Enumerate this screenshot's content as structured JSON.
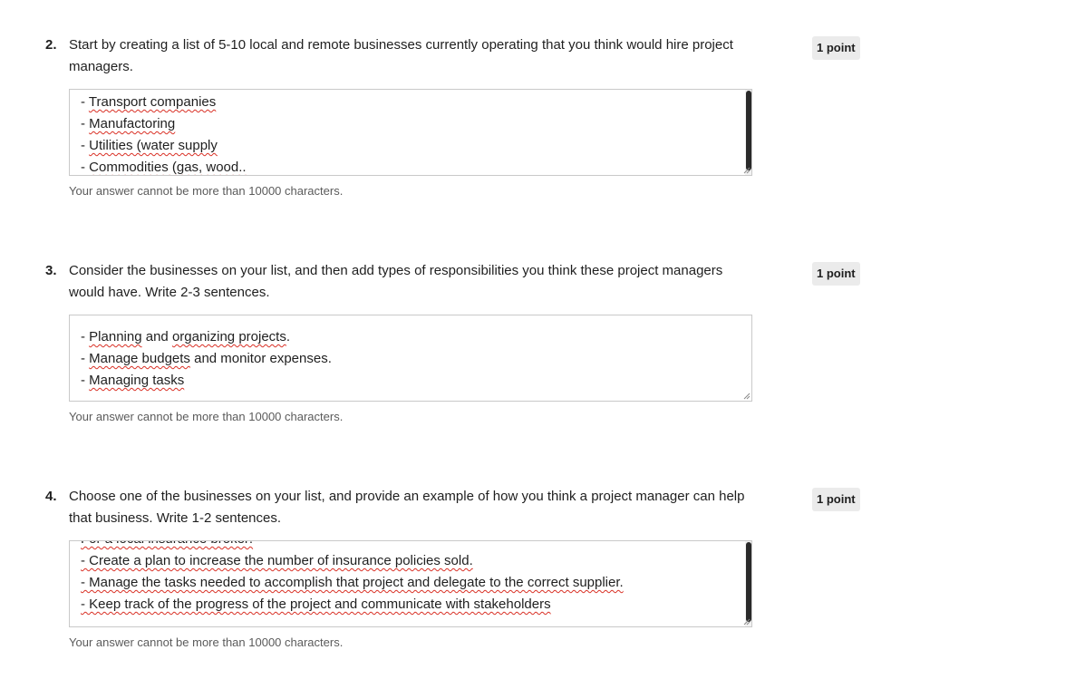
{
  "questions": [
    {
      "number": "2.",
      "text": "Start by creating a list of 5-10 local and remote businesses currently operating that you think would hire project managers.",
      "points": "1 point",
      "answer_lines": [
        "- Transport companies",
        "- Manufactoring",
        "- Utilities (water supply",
        "- Commodities (gas, wood.."
      ],
      "help": "Your answer cannot be more than 10000 characters."
    },
    {
      "number": "3.",
      "text": "Consider the businesses on your list, and then add types of responsibilities you think these project managers would have. Write 2-3 sentences.",
      "points": "1 point",
      "answer_lines": [
        "- Planning and organizing projects.",
        "- Manage budgets and monitor expenses.",
        "- Managing tasks"
      ],
      "help": "Your answer cannot be more than 10000 characters."
    },
    {
      "number": "4.",
      "text": "Choose one of the businesses on your list, and provide an example of how you think a project manager can help that business. Write 1-2 sentences.",
      "points": "1 point",
      "answer_lines": [
        "For a local insurance broker:",
        " -  Create a plan to increase the number of insurance policies sold.",
        " - Manage the tasks needed to accomplish that project and delegate to the correct supplier.",
        " -  Keep track of the progress of the project and communicate with stakeholders"
      ],
      "help": "Your answer cannot be more than 10000 characters."
    }
  ]
}
